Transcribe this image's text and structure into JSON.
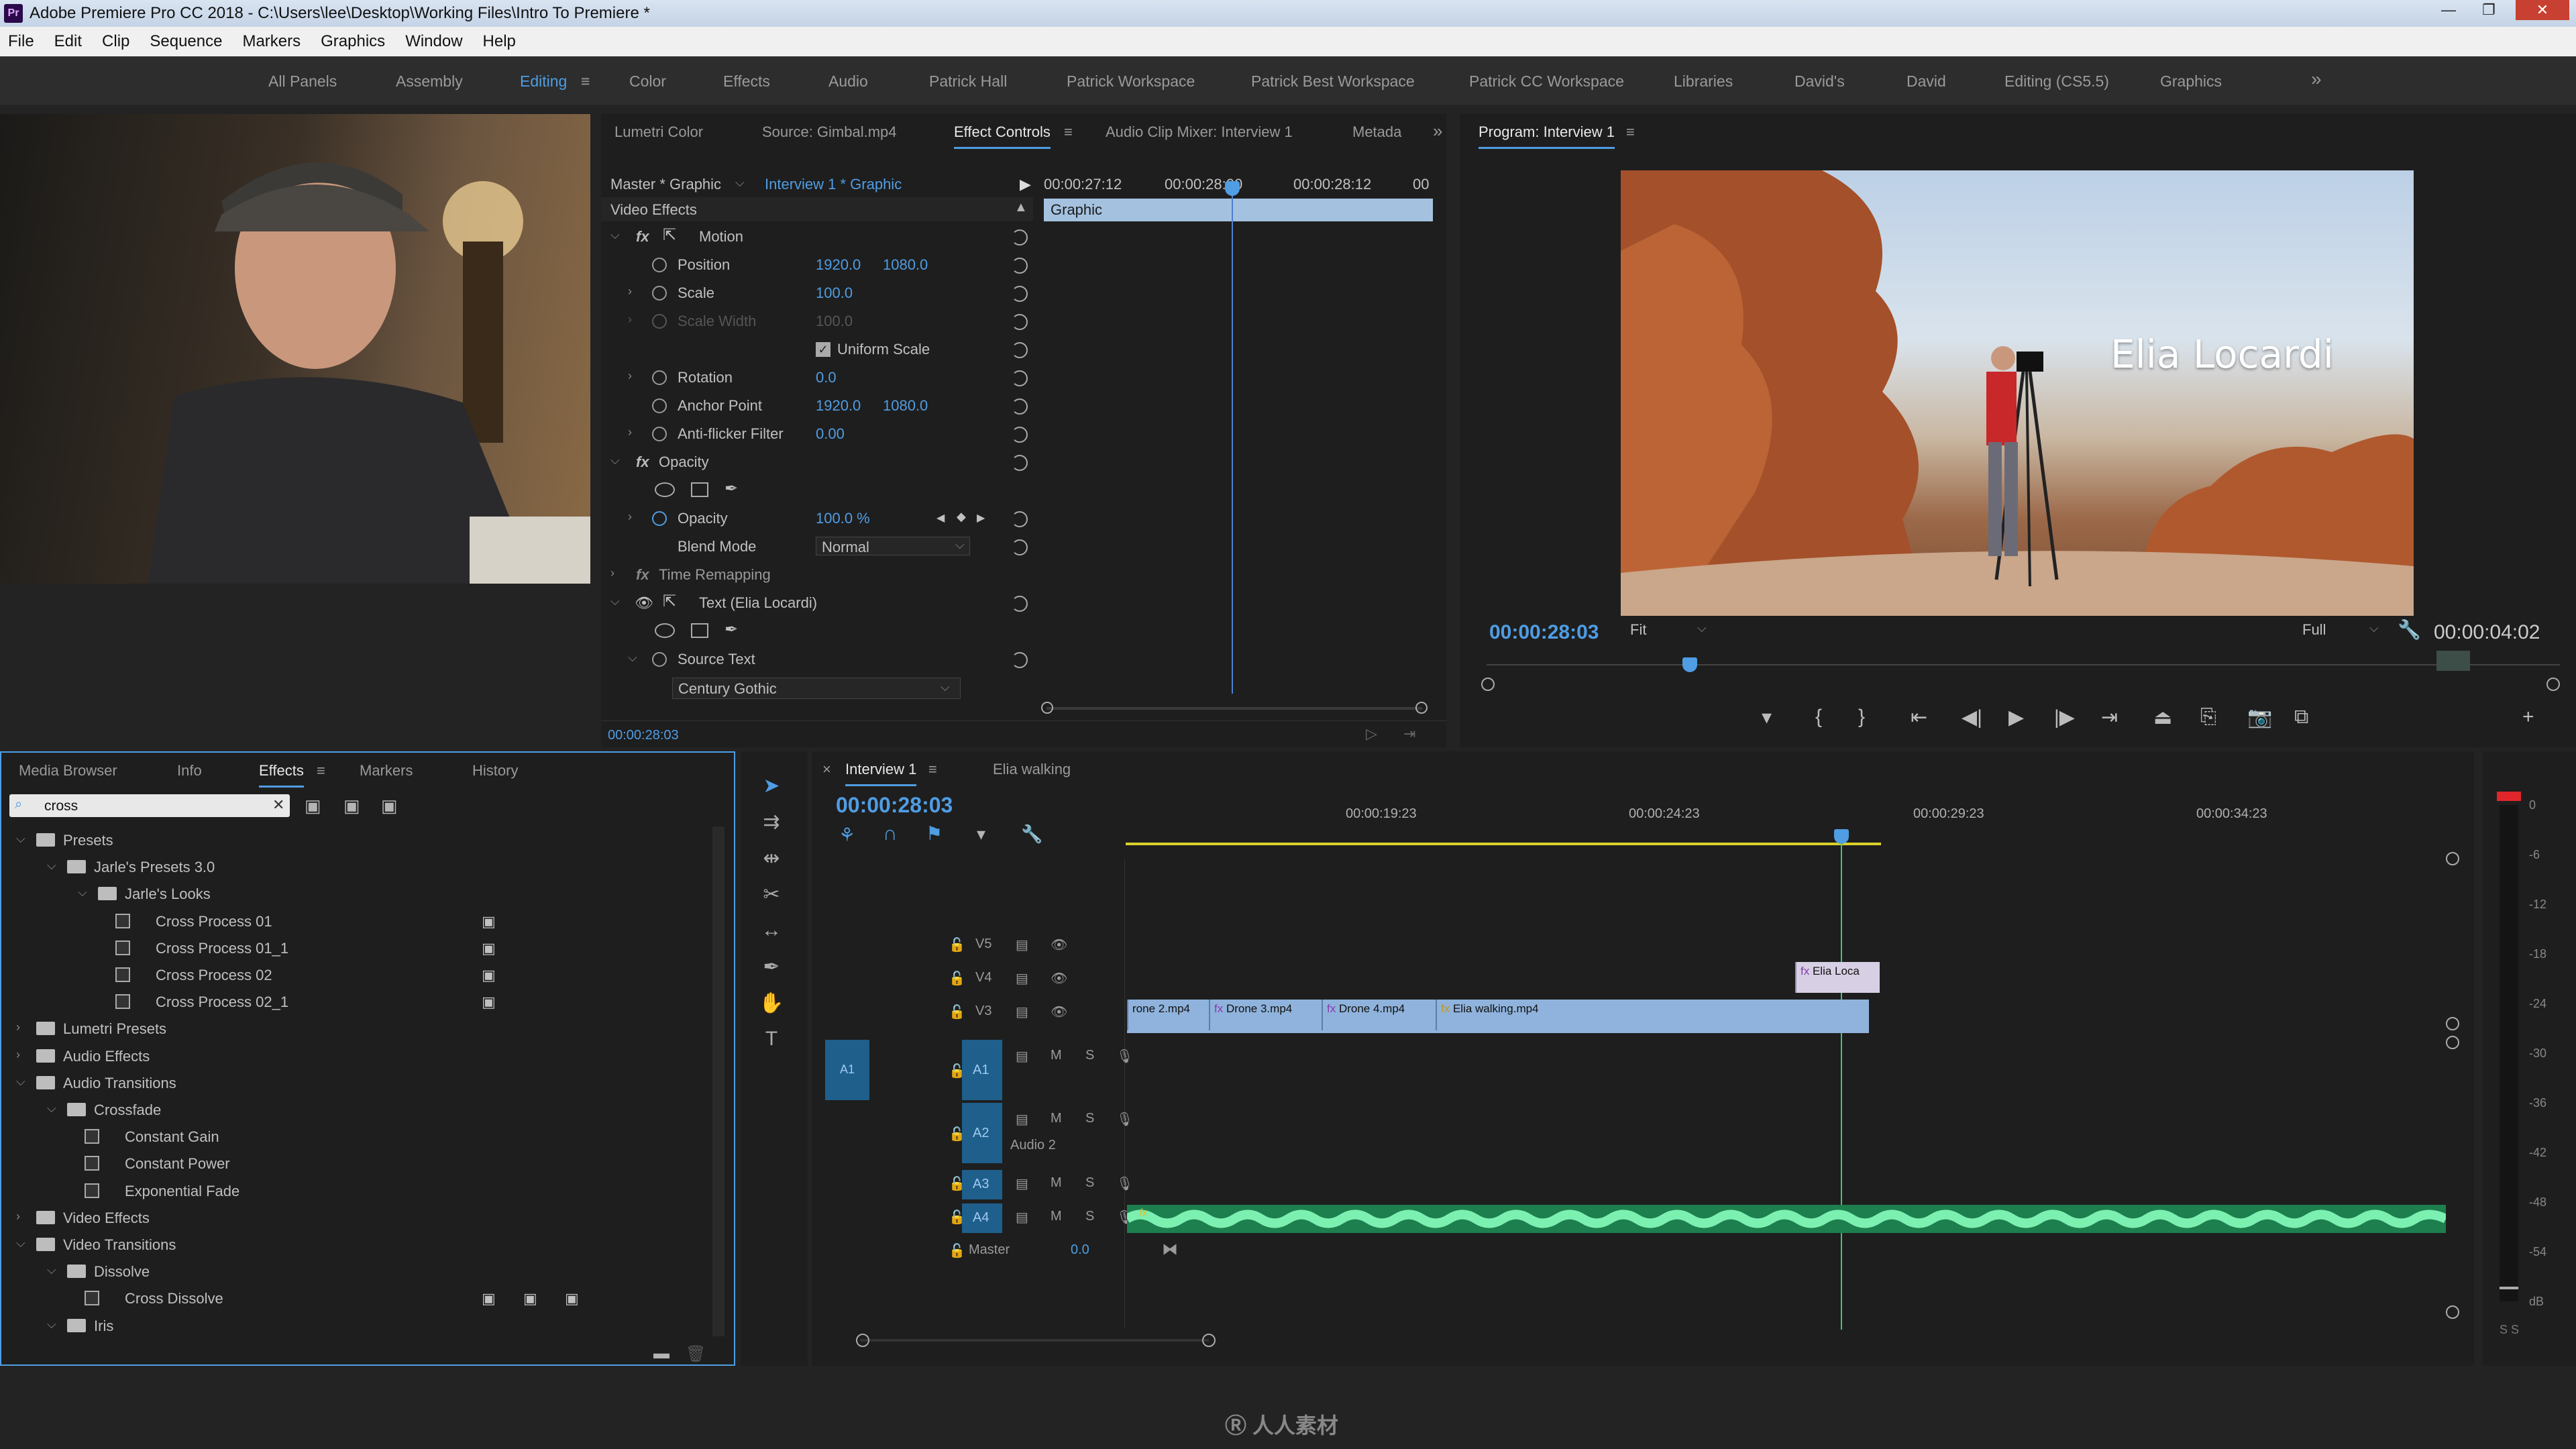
{
  "window": {
    "title": "Adobe Premiere Pro CC 2018 - C:\\Users\\lee\\Desktop\\Working Files\\Intro To Premiere *",
    "min": "—",
    "max": "❐",
    "close": "✕"
  },
  "menu": [
    "File",
    "Edit",
    "Clip",
    "Sequence",
    "Markers",
    "Graphics",
    "Window",
    "Help"
  ],
  "workspaces": [
    "All Panels",
    "Assembly",
    "Editing",
    "Color",
    "Effects",
    "Audio",
    "Patrick Hall",
    "Patrick Workspace",
    "Patrick Best Workspace",
    "Patrick CC Workspace",
    "Libraries",
    "David's",
    "David",
    "Editing (CS5.5)",
    "Graphics"
  ],
  "ws_more": "»",
  "source_panel": {
    "tabs": [
      "Lumetri Color",
      "Source: Gimbal.mp4",
      "Effect Controls",
      "Audio Clip Mixer: Interview 1",
      "Metada"
    ],
    "more": "»",
    "master": "Master * Graphic",
    "clip": "Interview 1 * Graphic",
    "times": [
      "00:00:27:12",
      "00:00:28:00",
      "00:00:28:12",
      "00"
    ],
    "graphic_bar": "Graphic",
    "section": "Video Effects",
    "current_time": "00:00:28:03",
    "rows": {
      "motion": "Motion",
      "position": "Position",
      "pos_x": "1920.0",
      "pos_y": "1080.0",
      "scale": "Scale",
      "scale_v": "100.0",
      "scale_width": "Scale Width",
      "scale_width_v": "100.0",
      "uniform": "Uniform Scale",
      "rotation": "Rotation",
      "rotation_v": "0.0",
      "anchor": "Anchor Point",
      "anchor_x": "1920.0",
      "anchor_y": "1080.0",
      "antiflicker": "Anti-flicker Filter",
      "antiflicker_v": "0.00",
      "opacity_grp": "Opacity",
      "opacity": "Opacity",
      "opacity_v": "100.0 %",
      "blend": "Blend Mode",
      "blend_v": "Normal",
      "time_remap": "Time Remapping",
      "text_layer": "Text (Elia Locardi)",
      "source_text": "Source Text",
      "font": "Century Gothic"
    }
  },
  "program": {
    "title": "Program: Interview 1",
    "overlay": "Elia Locardi",
    "timecode": "00:00:28:03",
    "fit": "Fit",
    "quality": "Full",
    "duration": "00:00:04:02"
  },
  "effects_panel": {
    "tabs": [
      "Media Browser",
      "Info",
      "Effects",
      "Markers",
      "History"
    ],
    "search": "cross",
    "tree": [
      {
        "label": "Presets",
        "level": 0,
        "type": "folder"
      },
      {
        "label": "Jarle's Presets 3.0",
        "level": 1,
        "type": "folder"
      },
      {
        "label": "Jarle's Looks",
        "level": 2,
        "type": "folder"
      },
      {
        "label": "Cross Process 01",
        "level": 3,
        "type": "preset"
      },
      {
        "label": "Cross Process 01_1",
        "level": 3,
        "type": "preset"
      },
      {
        "label": "Cross Process 02",
        "level": 3,
        "type": "preset"
      },
      {
        "label": "Cross Process 02_1",
        "level": 3,
        "type": "preset"
      },
      {
        "label": "Lumetri Presets",
        "level": 0,
        "type": "folder"
      },
      {
        "label": "Audio Effects",
        "level": 0,
        "type": "folder"
      },
      {
        "label": "Audio Transitions",
        "level": 0,
        "type": "folder"
      },
      {
        "label": "Crossfade",
        "level": 1,
        "type": "folder"
      },
      {
        "label": "Constant Gain",
        "level": 2,
        "type": "preset"
      },
      {
        "label": "Constant Power",
        "level": 2,
        "type": "preset"
      },
      {
        "label": "Exponential Fade",
        "level": 2,
        "type": "preset"
      },
      {
        "label": "Video Effects",
        "level": 0,
        "type": "folder"
      },
      {
        "label": "Video Transitions",
        "level": 0,
        "type": "folder"
      },
      {
        "label": "Dissolve",
        "level": 1,
        "type": "folder"
      },
      {
        "label": "Cross Dissolve",
        "level": 2,
        "type": "preset"
      },
      {
        "label": "Iris",
        "level": 1,
        "type": "folder"
      }
    ]
  },
  "timeline": {
    "tabs": [
      "Interview 1",
      "Elia walking"
    ],
    "timecode": "00:00:28:03",
    "ruler": [
      "00:00:19:23",
      "00:00:24:23",
      "00:00:29:23",
      "00:00:34:23"
    ],
    "tracks": {
      "v5": "V5",
      "v4": "V4",
      "v3": "V3",
      "a1": "A1",
      "a2": "A2",
      "a2name": "Audio 2",
      "a3": "A3",
      "a4": "A4",
      "master": "Master",
      "master_v": "0.0",
      "m": "M",
      "s": "S"
    },
    "clips": {
      "c1": "rone 2.mp4",
      "c2": "Drone 3.mp4",
      "c3": "Drone 4.mp4",
      "c4": "Elia walking.mp4",
      "graphic": "Elia Loca"
    }
  },
  "meter": {
    "labels": [
      "0",
      "-6",
      "-12",
      "-18",
      "-24",
      "-30",
      "-36",
      "-42",
      "-48",
      "-54",
      "dB"
    ],
    "bottom": "S  S"
  },
  "watermark": "人人素材"
}
